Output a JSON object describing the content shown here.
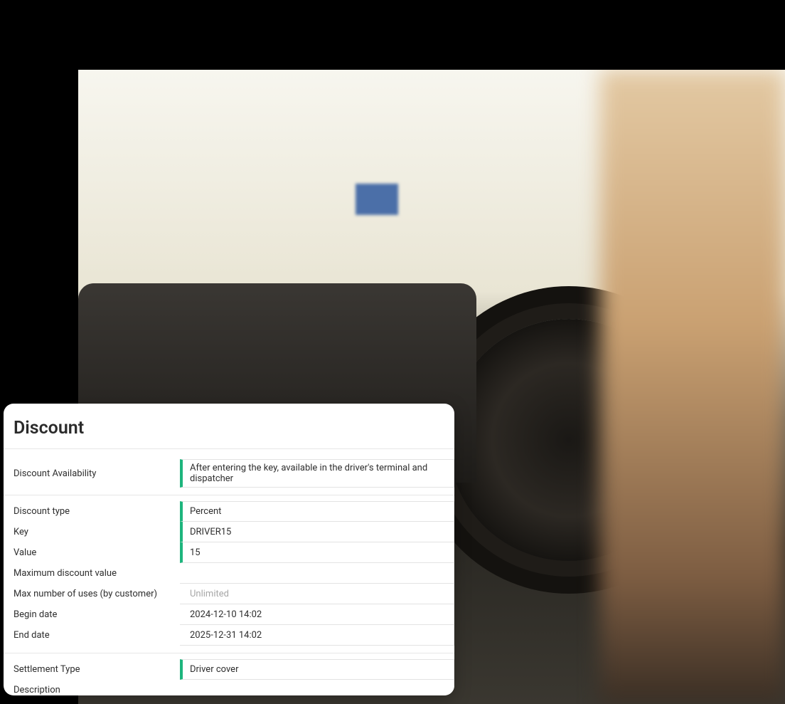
{
  "panel": {
    "title": "Discount",
    "fields": {
      "availability": {
        "label": "Discount Availability",
        "value": "After entering the key, available in the driver's terminal and dispatcher"
      },
      "type": {
        "label": "Discount type",
        "value": "Percent"
      },
      "key": {
        "label": "Key",
        "value": "DRIVER15"
      },
      "value": {
        "label": "Value",
        "value": "15"
      },
      "maxValue": {
        "label": "Maximum discount value",
        "value": ""
      },
      "maxUses": {
        "label": "Max number of uses (by customer)",
        "value": "",
        "placeholder": "Unlimited"
      },
      "beginDate": {
        "label": "Begin date",
        "value": "2024-12-10 14:02"
      },
      "endDate": {
        "label": "End date",
        "value": "2025-12-31 14:02"
      },
      "settlement": {
        "label": "Settlement Type",
        "value": "Driver cover"
      },
      "description": {
        "label": "Description",
        "value": ""
      }
    }
  },
  "colors": {
    "accent": "#1db57d"
  }
}
